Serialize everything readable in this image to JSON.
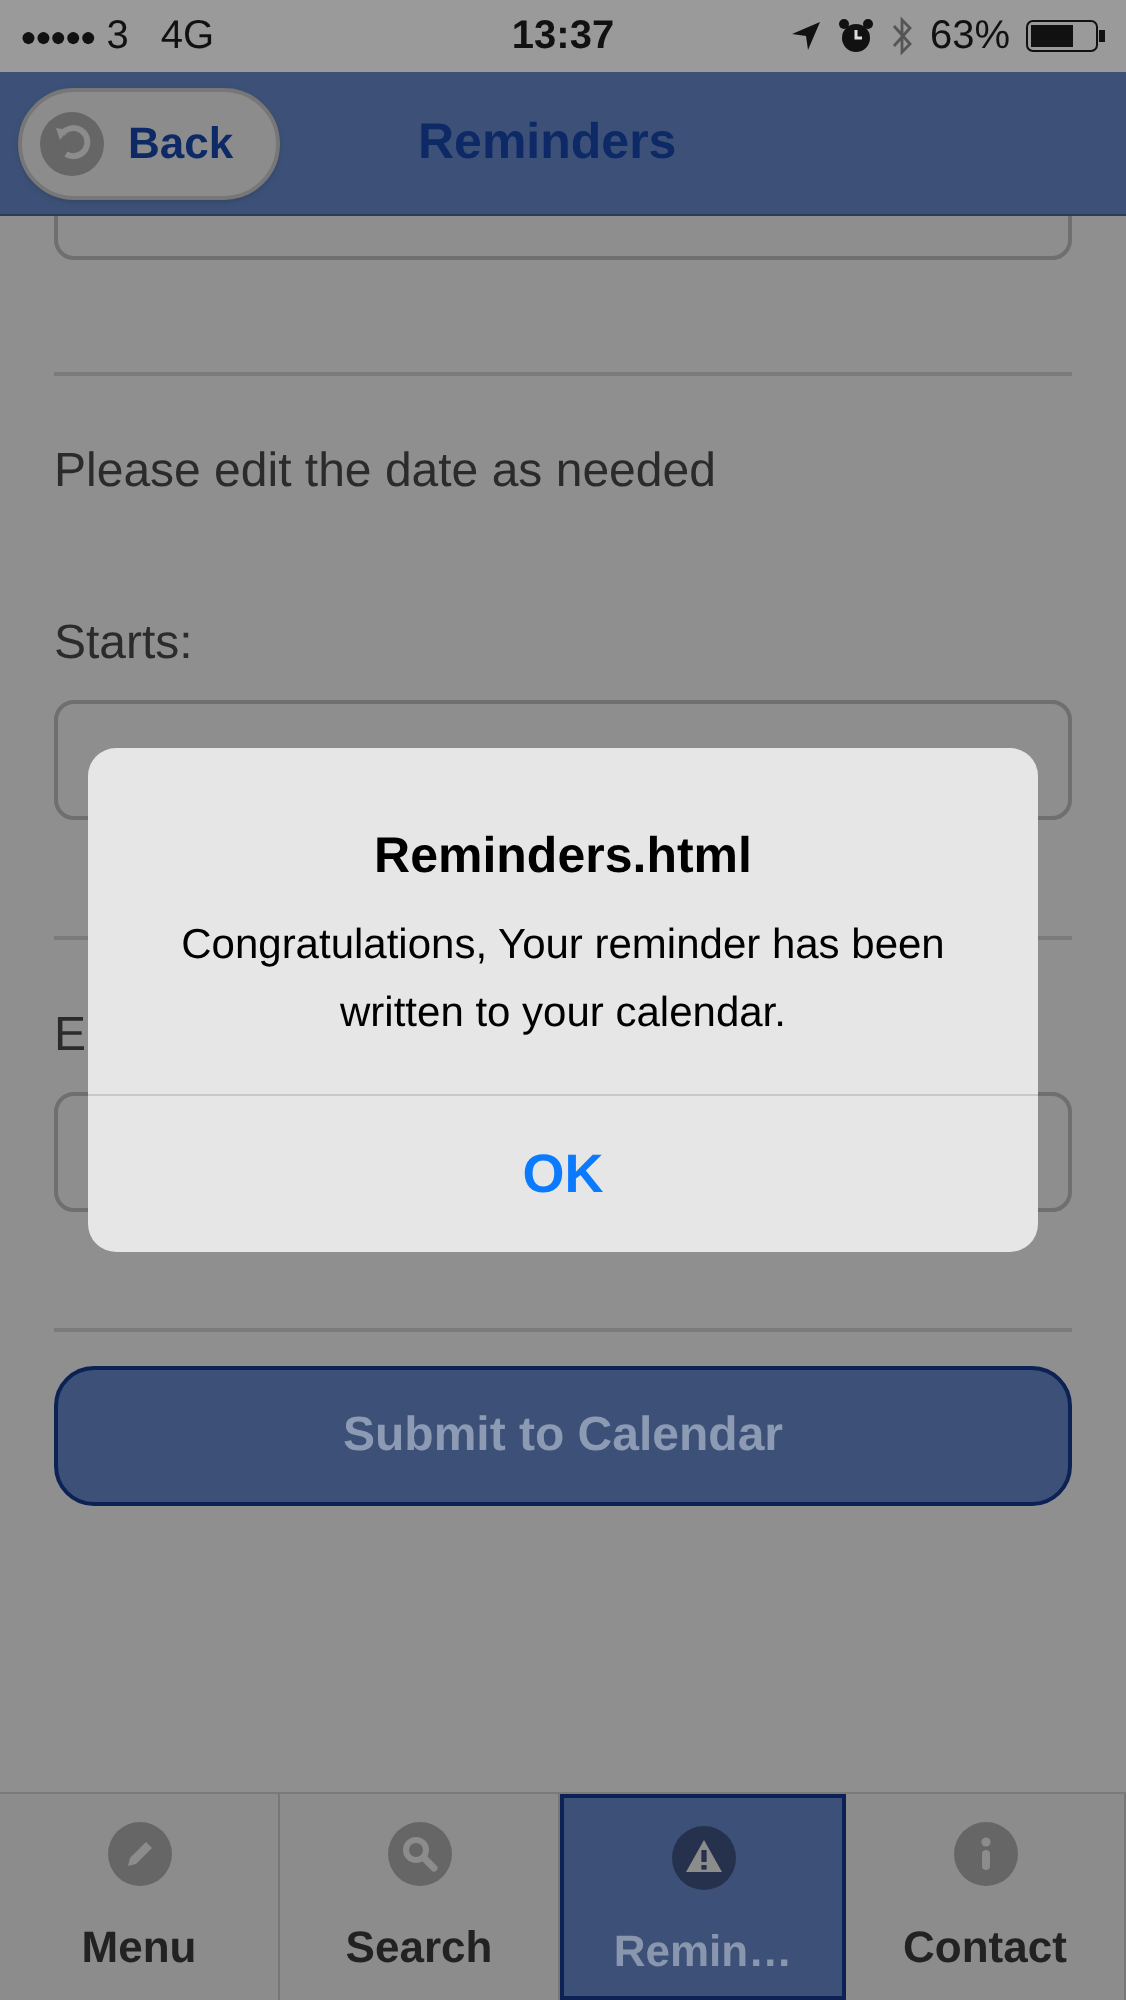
{
  "status_bar": {
    "signal": "●●●●●",
    "carrier": "3",
    "network": "4G",
    "time": "13:37",
    "battery": "63%"
  },
  "header": {
    "back_label": "Back",
    "title": "Reminders"
  },
  "form": [
    {
      "kind": "field"
    },
    {
      "kind": "divider"
    },
    {
      "kind": "text",
      "text": "Please edit the date as needed"
    },
    {
      "kind": "label",
      "text": "Starts:"
    },
    {
      "kind": "field"
    },
    {
      "kind": "divider"
    },
    {
      "kind": "label",
      "text": "E"
    },
    {
      "kind": "field"
    },
    {
      "kind": "divider"
    }
  ],
  "submit_button": {
    "label": "Submit to Calendar"
  },
  "tab_bar": [
    {
      "label": "Menu",
      "selected": false
    },
    {
      "label": "Search",
      "selected": false
    },
    {
      "label": "Remin…",
      "selected": true
    },
    {
      "label": "Contact",
      "selected": false
    }
  ],
  "alert": {
    "title": "Reminders.html",
    "message": "Congratulations, Your reminder has been written to your calendar.",
    "button": "OK"
  }
}
